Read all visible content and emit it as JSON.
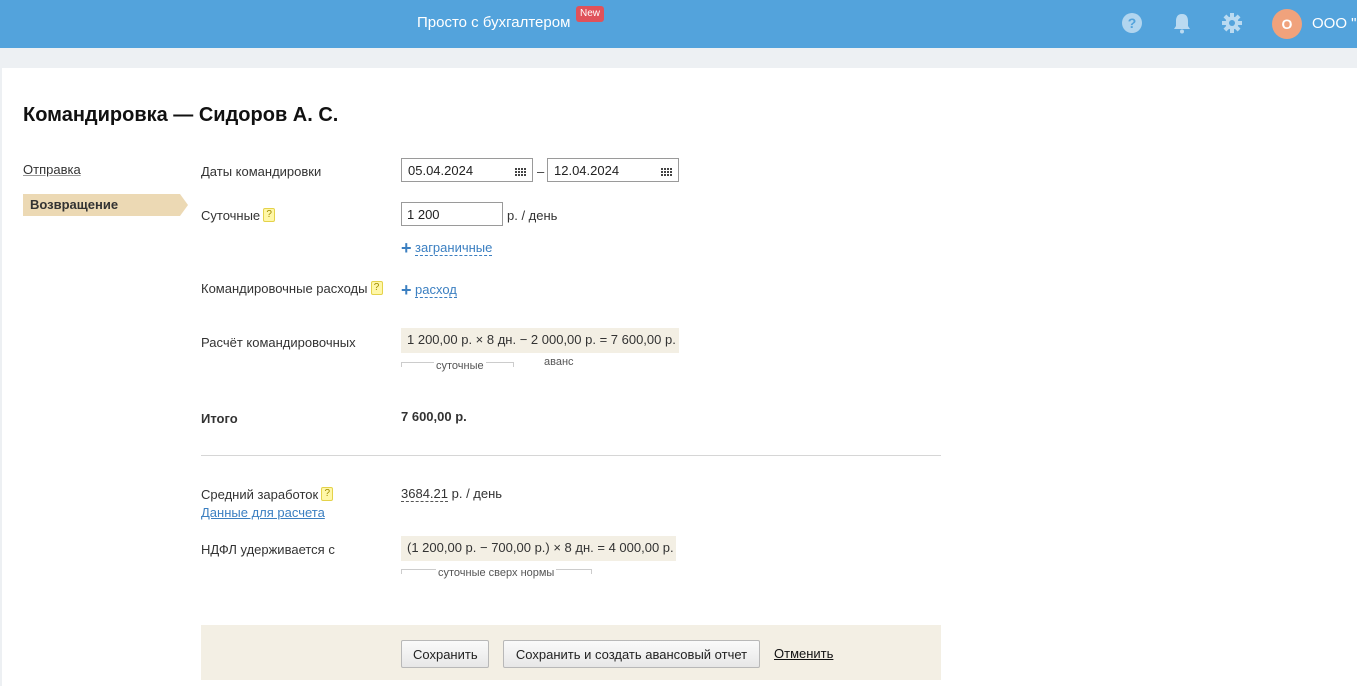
{
  "header": {
    "brand": "Просто с бухгалтером",
    "badge": "New",
    "avatar_letter": "О",
    "org_name": "ООО \"М"
  },
  "page": {
    "title": "Командировка — Сидоров А. С."
  },
  "sidebar": {
    "items": [
      {
        "label": "Отправка",
        "active": false
      },
      {
        "label": "Возвращение",
        "active": true
      }
    ]
  },
  "form": {
    "dates": {
      "label": "Даты командировки",
      "start": "05.04.2024",
      "separator": "–",
      "end": "12.04.2024"
    },
    "per_diem": {
      "label": "Суточные",
      "value": "1 200",
      "unit": "р. / день",
      "add_foreign": "заграничные"
    },
    "expenses": {
      "label": "Командировочные расходы",
      "add_expense": "расход"
    },
    "calculation": {
      "label": "Расчёт командировочных",
      "formula": "1 200,00 р. × 8 дн. − 2 000,00 р. = 7 600,00 р.",
      "brace_per_diem": "суточные",
      "brace_advance": "аванс"
    },
    "total": {
      "label": "Итого",
      "value": "7 600,00 р."
    },
    "avg_salary": {
      "label": "Средний заработок",
      "value": "3684.21",
      "unit": "р. / день",
      "data_link": "Данные для расчета"
    },
    "ndfl": {
      "label": "НДФЛ удерживается с",
      "formula": "(1 200,00 р. − 700,00 р.) × 8 дн. = 4 000,00 р.",
      "brace_label": "суточные сверх нормы"
    }
  },
  "actions": {
    "save": "Сохранить",
    "save_and_report": "Сохранить и создать авансовый отчет",
    "cancel": "Отменить"
  },
  "colors": {
    "header_bg": "#53a3dc",
    "active_tab": "#ecd9b4",
    "formula_bg": "#f3efe4",
    "link": "#3b7fc1",
    "badge": "#e0525a"
  },
  "icons": [
    "help-icon",
    "bell-icon",
    "gear-icon",
    "calendar-icon",
    "plus-icon",
    "question-hint-icon"
  ]
}
